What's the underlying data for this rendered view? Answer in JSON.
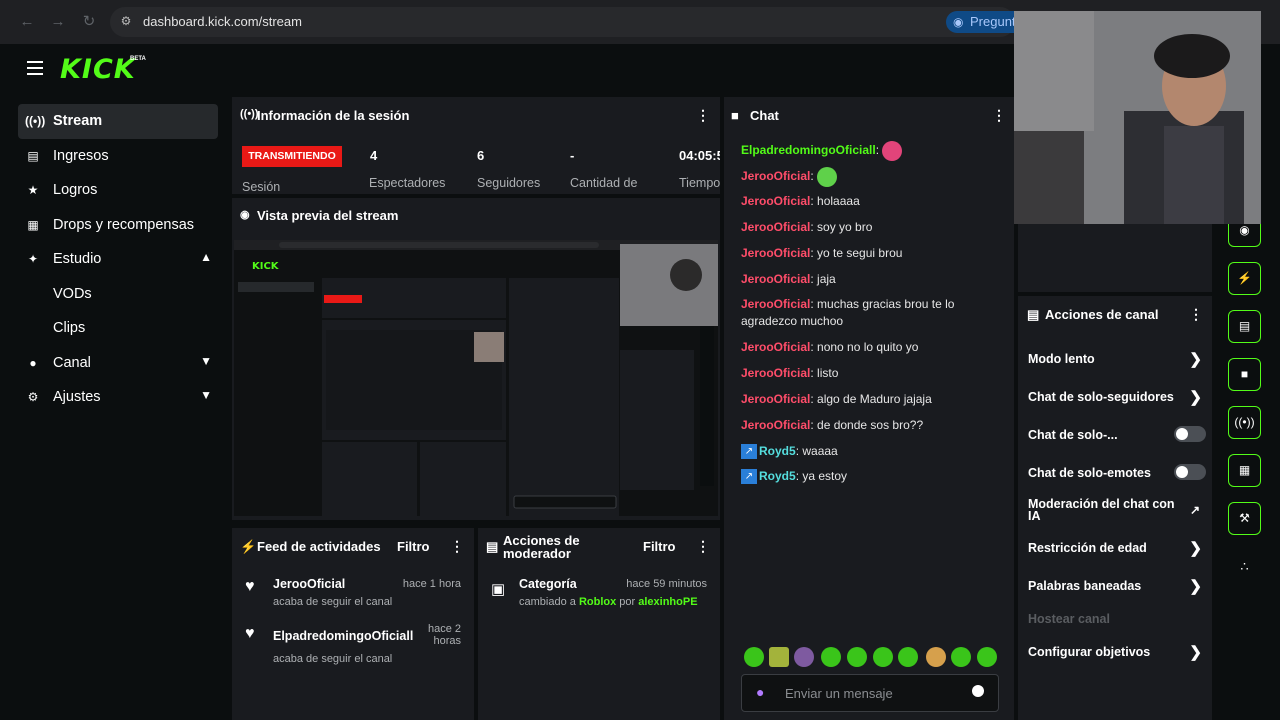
{
  "browser": {
    "url": "dashboard.kick.com/stream",
    "ask_label": "Pregunt"
  },
  "brand": {
    "logo": "KICK",
    "beta": "BETA"
  },
  "sidebar": {
    "items": [
      {
        "label": "Stream",
        "icon": "broadcast-icon"
      },
      {
        "label": "Ingresos",
        "icon": "chart-icon"
      },
      {
        "label": "Logros",
        "icon": "trophy-icon"
      },
      {
        "label": "Drops y recompensas",
        "icon": "gift-icon"
      },
      {
        "label": "Estudio",
        "icon": "studio-icon"
      },
      {
        "label": "VODs"
      },
      {
        "label": "Clips"
      },
      {
        "label": "Canal",
        "icon": "user-icon"
      },
      {
        "label": "Ajustes",
        "icon": "gear-icon"
      }
    ]
  },
  "session": {
    "title": "Información de la sesión",
    "status": "TRANSMITIENDO",
    "status_label": "Sesión",
    "stats": [
      {
        "value": "4",
        "label": "Espectadores"
      },
      {
        "value": "6",
        "label": "Seguidores"
      },
      {
        "value": "-",
        "label": "Cantidad de"
      },
      {
        "value": "04:05:5",
        "label": "Tiempo"
      }
    ]
  },
  "preview": {
    "title": "Vista previa del stream"
  },
  "feed": {
    "title": "Feed de actividades",
    "filter": "Filtro",
    "items": [
      {
        "user": "JerooOficial",
        "action": "acaba de seguir el canal",
        "time": "hace 1 hora"
      },
      {
        "user": "ElpadredomingoOficiall",
        "action": "acaba de seguir el canal",
        "time": "hace 2 horas"
      }
    ]
  },
  "mod_actions": {
    "title": "Acciones de moderador",
    "filter": "Filtro",
    "item": {
      "title": "Categoría",
      "time": "hace 59 minutos",
      "prefix": "cambiado a",
      "category": "Roblox",
      "by": "por",
      "mod": "alexinhoPE"
    }
  },
  "chat": {
    "title": "Chat",
    "messages": [
      {
        "user": "ElpadredomingoOficiall",
        "text": "",
        "color": "green"
      },
      {
        "user": "JerooOficial",
        "text": "",
        "color": "red"
      },
      {
        "user": "JerooOficial",
        "text": "holaaaa",
        "color": "red"
      },
      {
        "user": "JerooOficial",
        "text": "soy yo bro",
        "color": "red"
      },
      {
        "user": "JerooOficial",
        "text": "yo te segui brou",
        "color": "red"
      },
      {
        "user": "JerooOficial",
        "text": "jaja",
        "color": "red"
      },
      {
        "user": "JerooOficial",
        "text": "muchas gracias brou te lo agradezco muchoo",
        "color": "red"
      },
      {
        "user": "JerooOficial",
        "text": "nono no lo quito yo",
        "color": "red"
      },
      {
        "user": "JerooOficial",
        "text": "listo",
        "color": "red"
      },
      {
        "user": "JerooOficial",
        "text": "algo de Maduro jajaja",
        "color": "red"
      },
      {
        "user": "JerooOficial",
        "text": "de donde sos bro??",
        "color": "red"
      },
      {
        "user": "Royd5",
        "text": "waaaa",
        "color": "teal"
      },
      {
        "user": "Royd5",
        "text": "ya estoy",
        "color": "teal"
      }
    ],
    "placeholder": "Enviar un mensaje"
  },
  "channel_actions": {
    "title": "Acciones de canal",
    "items": [
      {
        "label": "Modo lento",
        "kind": "chevron"
      },
      {
        "label": "Chat de solo-seguidores",
        "kind": "chevron"
      },
      {
        "label": "Chat de solo-...",
        "kind": "toggle"
      },
      {
        "label": "Chat de solo-emotes",
        "kind": "toggle"
      },
      {
        "label": "Moderación del chat con IA",
        "kind": "external"
      },
      {
        "label": "Restricción de edad",
        "kind": "chevron"
      },
      {
        "label": "Palabras baneadas",
        "kind": "chevron"
      },
      {
        "label": "Hostear canal",
        "kind": "disabled"
      },
      {
        "label": "Configurar objetivos",
        "kind": "chevron"
      }
    ]
  },
  "colors": {
    "accent": "#53fc18",
    "live": "#e91916",
    "panel": "#191b1f",
    "bg": "#0b0e0f"
  }
}
